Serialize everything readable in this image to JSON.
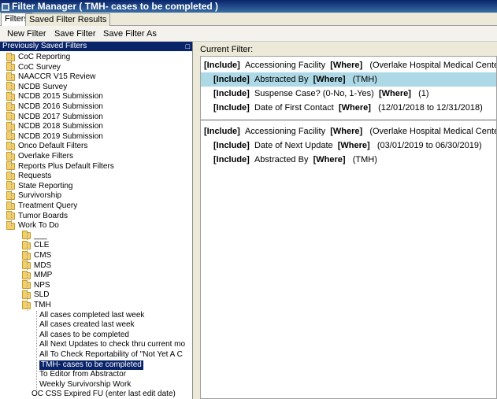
{
  "window": {
    "title": "Filter Manager ( TMH-  cases to be completed )"
  },
  "tabs": [
    {
      "label": "Filters"
    },
    {
      "label": "Saved Filter Results"
    }
  ],
  "toolbar": {
    "new_filter": "New Filter",
    "save_filter": "Save Filter",
    "save_filter_as": "Save Filter As"
  },
  "left_panel": {
    "header": "Previously Saved Filters",
    "pin": "☐",
    "items": [
      "CoC Reporting",
      "CoC Survey",
      "NAACCR V15 Review",
      "NCDB Survey",
      "NCDB 2015 Submission",
      "NCDB 2016 Submission",
      "NCDB 2017 Submission",
      "NCDB 2018 Submission",
      "NCDB 2019 Submission",
      "Onco Default Filters",
      "Overlake Filters",
      "Reports Plus Default Filters",
      "Requests",
      "State Reporting",
      "Survivorship",
      "Treatment Query",
      "Tumor Boards",
      "Work To Do"
    ],
    "work_to_do_children": [
      "___",
      "CLE",
      "CMS",
      "MDS",
      "MMP",
      "NPS",
      "SLD",
      "TMH"
    ],
    "tmh_children": [
      "All cases completed last week",
      "All cases created last week",
      "All cases to be completed",
      "All Next Updates to check thru current mo",
      "All To Check Reportability of \"Not Yet A C",
      "TMH- cases to be completed",
      "To Editor from Abstractor",
      "Weekly Survivorship Work"
    ],
    "bottom_item": "OC CSS Expired FU (enter last edit date)"
  },
  "current_filter": {
    "label": "Current Filter:",
    "group1": [
      {
        "include": "[Include]",
        "field": "Accessioning Facility",
        "where": "[Where]",
        "value": "(Overlake Hospital Medical Center)"
      },
      {
        "include": "[Include]",
        "field": "Abstracted By",
        "where": "[Where]",
        "value": "(TMH)"
      },
      {
        "include": "[Include]",
        "field": "Suspense Case? (0-No, 1-Yes)",
        "where": "[Where]",
        "value": "(1)"
      },
      {
        "include": "[Include]",
        "field": "Date of First Contact",
        "where": "[Where]",
        "value": "(12/01/2018 to 12/31/2018)"
      }
    ],
    "group2": [
      {
        "include": "[Include]",
        "field": "Accessioning Facility",
        "where": "[Where]",
        "value": "(Overlake Hospital Medical Center)"
      },
      {
        "include": "[Include]",
        "field": "Date of Next Update",
        "where": "[Where]",
        "value": "(03/01/2019 to 06/30/2019)"
      },
      {
        "include": "[Include]",
        "field": "Abstracted By",
        "where": "[Where]",
        "value": "(TMH)"
      }
    ]
  },
  "colors": {
    "titlebar": "#0a246a",
    "selection": "#0a246a",
    "highlight_row": "#add8e6"
  }
}
